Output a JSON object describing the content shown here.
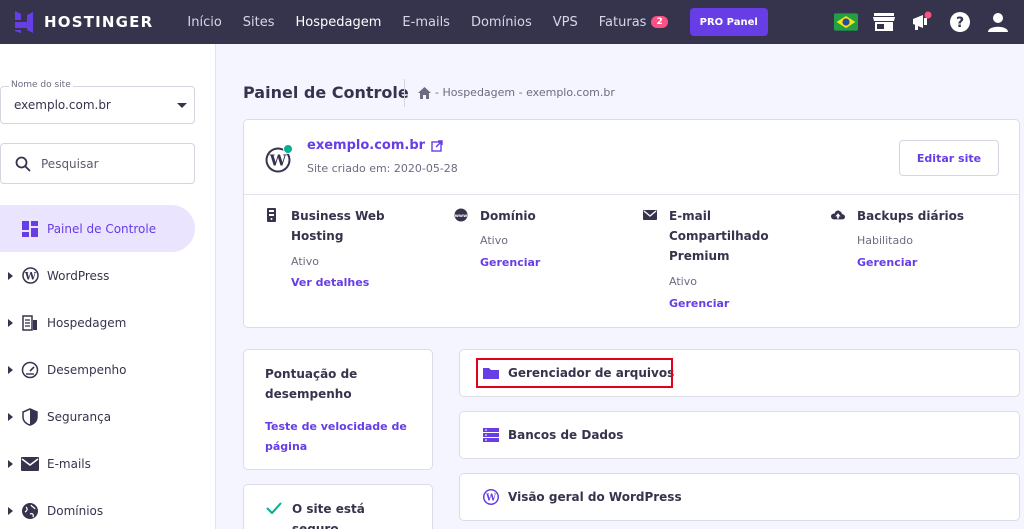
{
  "brand": {
    "name": "HOSTINGER"
  },
  "nav": {
    "items": [
      {
        "label": "Início",
        "active": false
      },
      {
        "label": "Sites",
        "active": false
      },
      {
        "label": "Hospedagem",
        "active": true
      },
      {
        "label": "E-mails",
        "active": false
      },
      {
        "label": "Domínios",
        "active": false
      },
      {
        "label": "VPS",
        "active": false
      },
      {
        "label": "Faturas",
        "active": false,
        "badge": "2"
      }
    ],
    "pro_button": "PRO Panel",
    "icons": [
      "brazil-flag-icon",
      "store-icon",
      "notifications-icon",
      "help-icon",
      "account-icon"
    ]
  },
  "sidebar": {
    "site_select": {
      "label": "Nome do site",
      "value": "exemplo.com.br"
    },
    "search": {
      "placeholder": "Pesquisar"
    },
    "items": [
      {
        "label": "Painel de Controle",
        "icon": "dashboard-icon",
        "active": true
      },
      {
        "label": "WordPress",
        "icon": "wordpress-icon",
        "active": false
      },
      {
        "label": "Hospedagem",
        "icon": "hosting-icon",
        "active": false
      },
      {
        "label": "Desempenho",
        "icon": "gauge-icon",
        "active": false
      },
      {
        "label": "Segurança",
        "icon": "shield-icon",
        "active": false
      },
      {
        "label": "E-mails",
        "icon": "mail-icon",
        "active": false
      },
      {
        "label": "Domínios",
        "icon": "globe-icon",
        "active": false
      }
    ]
  },
  "main": {
    "title": "Painel de Controle",
    "breadcrumb": "- Hospedagem  - exemplo.com.br",
    "site": {
      "domain": "exemplo.com.br",
      "created": "Site criado em: 2020-05-28",
      "edit_button": "Editar site"
    },
    "services": [
      {
        "name": "Business Web Hosting",
        "status": "Ativo",
        "link": "Ver detalhes",
        "icon": "server-icon"
      },
      {
        "name": "Domínio",
        "status": "Ativo",
        "link": "Gerenciar",
        "icon": "www-icon"
      },
      {
        "name": "E-mail Compartilhado Premium",
        "status": "Ativo",
        "link": "Gerenciar",
        "icon": "email-icon"
      },
      {
        "name": "Backups diários",
        "status": "Habilitado",
        "link": "Gerenciar",
        "icon": "cloud-upload-icon"
      }
    ],
    "performance": {
      "title": "Pontuação de desempenho",
      "link": "Teste de velocidade de página"
    },
    "secure": {
      "text": "O site está seguro"
    },
    "tools": [
      {
        "label": "Gerenciador de arquivos",
        "icon": "folder-icon",
        "highlighted": true
      },
      {
        "label": "Bancos de Dados",
        "icon": "database-icon",
        "highlighted": false
      },
      {
        "label": "Visão geral do WordPress",
        "icon": "wordpress-icon",
        "highlighted": false
      }
    ]
  },
  "colors": {
    "accent": "#673de6",
    "nav_bg": "#36344d",
    "badge": "#fc5185",
    "success": "#00b090",
    "highlight": "#e4001b"
  }
}
